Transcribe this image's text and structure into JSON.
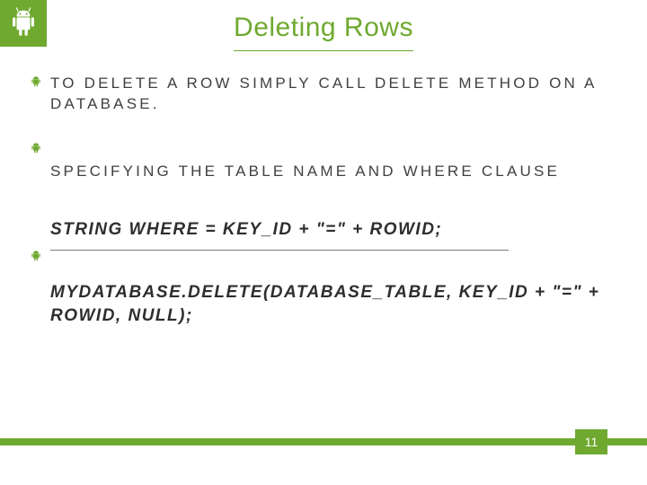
{
  "title": "Deleting Rows",
  "items": [
    {
      "kind": "text",
      "content": "TO DELETE A ROW SIMPLY CALL DELETE METHOD ON A DATABASE."
    },
    {
      "kind": "empty-bullet"
    },
    {
      "kind": "text",
      "content": "SPECIFYING THE TABLE NAME AND WHERE CLAUSE"
    },
    {
      "kind": "code",
      "content": "STRING WHERE = KEY_ID + \"=\" + ROWID;",
      "hr": true
    },
    {
      "kind": "code",
      "content": "MYDATABASE.DELETE(DATABASE_TABLE, KEY_ID + \"=\" + ROWID, NULL);"
    }
  ],
  "page_number": "11",
  "colors": {
    "accent": "#6fa92f"
  }
}
